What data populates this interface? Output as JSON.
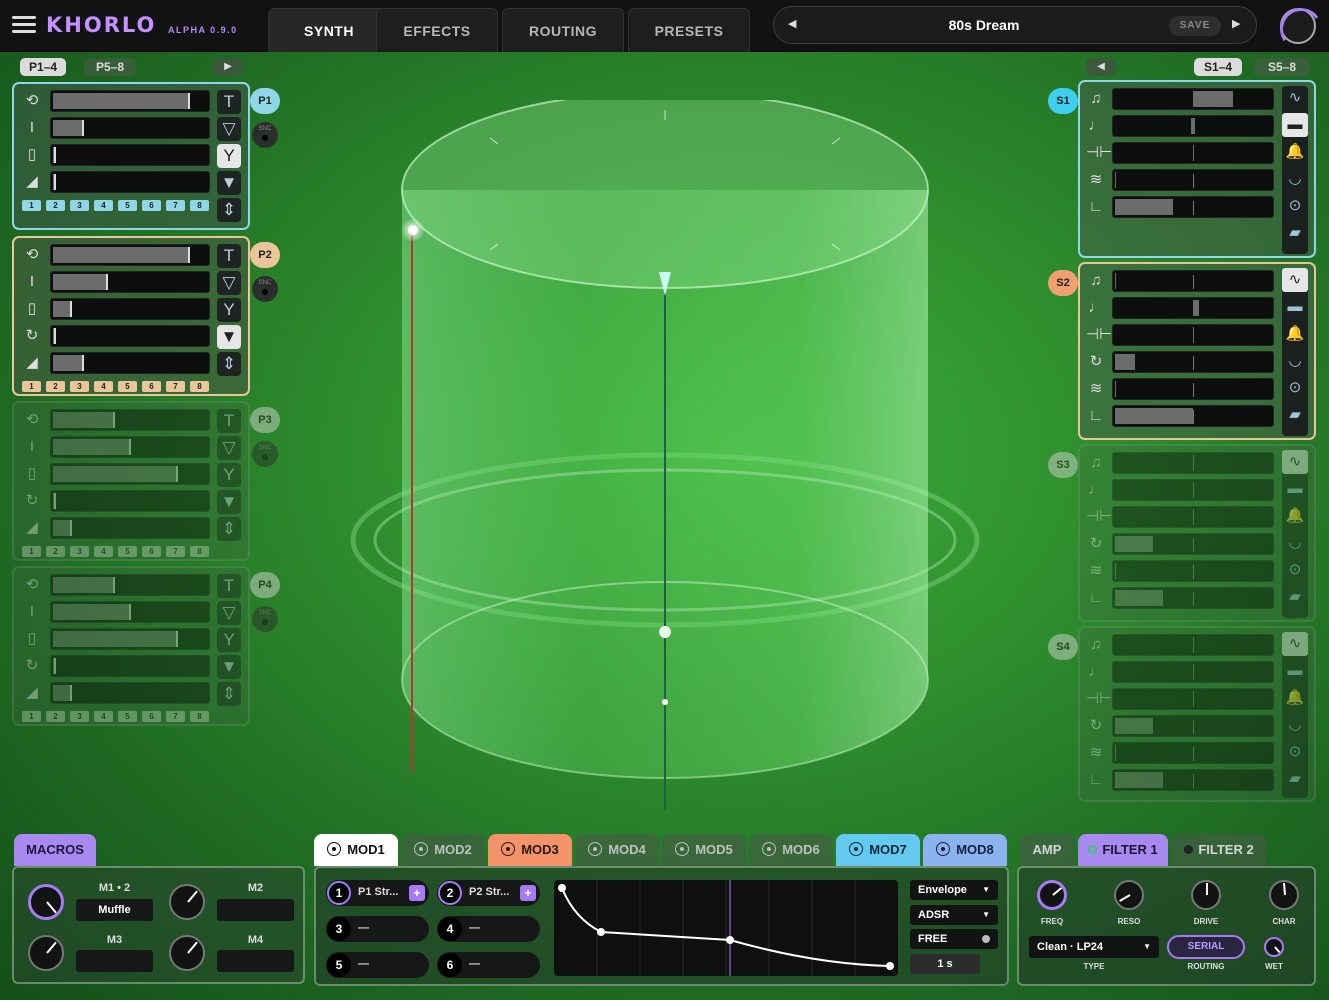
{
  "app": {
    "name": "KHORLO",
    "version": "ALPHA 0.9.0"
  },
  "tabs": [
    "SYNTH",
    "EFFECTS",
    "ROUTING",
    "PRESETS"
  ],
  "preset": {
    "name": "80s Dream",
    "save_label": "SAVE",
    "prev": "◀",
    "next": "▶"
  },
  "left_pager": {
    "p1_4": "P1–4",
    "p5_8": "P5–8",
    "next": "▶"
  },
  "right_pager": {
    "prev": "◀",
    "s1_4": "S1–4",
    "s5_8": "S5–8"
  },
  "players": [
    {
      "label": "P1",
      "snc": "SNC",
      "color": "#8fd6e6",
      "num_color": "#8fd6e6",
      "levels": [
        0.88,
        0.2,
        0.02,
        0.02
      ]
    },
    {
      "label": "P2",
      "snc": "SNC",
      "color": "#e8c69a",
      "num_color": "#e8c69a",
      "levels": [
        0.88,
        0.35,
        0.12,
        0.02,
        0.2
      ]
    },
    {
      "label": "P3",
      "snc": "SNC",
      "color": "#b6c8b3",
      "num_color": "#b6c8b3",
      "levels": [
        0.4,
        0.5,
        0.8,
        0.02,
        0.12
      ]
    },
    {
      "label": "P4",
      "snc": "SNC",
      "color": "#b6c8b3",
      "num_color": "#b6c8b3",
      "levels": [
        0.4,
        0.5,
        0.8,
        0.02,
        0.12
      ]
    }
  ],
  "step_numbers": [
    "1",
    "2",
    "3",
    "4",
    "5",
    "6",
    "7",
    "8"
  ],
  "sources": [
    {
      "label": "S1",
      "color": "#3fd0f0"
    },
    {
      "label": "S2",
      "color": "#f0a070"
    },
    {
      "label": "S3",
      "color": "#b6c8b3"
    },
    {
      "label": "S4",
      "color": "#b6c8b3"
    }
  ],
  "macros": {
    "tab": "MACROS",
    "m1": {
      "label": "M1 • 2",
      "value": "Muffle"
    },
    "m2": {
      "label": "M2",
      "value": ""
    },
    "m3": {
      "label": "M3",
      "value": ""
    },
    "m4": {
      "label": "M4",
      "value": ""
    }
  },
  "mod_tabs": [
    {
      "label": "MOD1",
      "bg": "#ffffff",
      "fg": "#111"
    },
    {
      "label": "MOD2",
      "bg": "",
      "fg": ""
    },
    {
      "label": "MOD3",
      "bg": "#f2936a",
      "fg": "#2a1a12"
    },
    {
      "label": "MOD4",
      "bg": "",
      "fg": ""
    },
    {
      "label": "MOD5",
      "bg": "",
      "fg": ""
    },
    {
      "label": "MOD6",
      "bg": "",
      "fg": ""
    },
    {
      "label": "MOD7",
      "bg": "#63c9ef",
      "fg": "#0d2a36"
    },
    {
      "label": "MOD8",
      "bg": "#8cb3f0",
      "fg": "#12223d"
    }
  ],
  "mod_slots": [
    {
      "n": "1",
      "t": "P1 Str...",
      "plus": "+"
    },
    {
      "n": "2",
      "t": "P2 Str...",
      "plus": "+"
    },
    {
      "n": "3",
      "t": "—"
    },
    {
      "n": "4",
      "t": "—"
    },
    {
      "n": "5",
      "t": "—"
    },
    {
      "n": "6",
      "t": "—"
    }
  ],
  "mod_controls": {
    "type": "Envelope",
    "mode": "ADSR",
    "sync": "FREE",
    "time": "1 s"
  },
  "filter_tabs": [
    "AMP",
    "FILTER 1",
    "FILTER 2"
  ],
  "filter": {
    "knobs": [
      "FREQ",
      "RESO",
      "DRIVE",
      "CHAR"
    ],
    "type_value": "Clean · LP24",
    "type_label": "TYPE",
    "routing_value": "SERIAL",
    "routing_label": "ROUTING",
    "wet_label": "WET"
  },
  "colors": {
    "accent": "#a77bf5",
    "p1": "#8fd6e6",
    "p2": "#e8c69a",
    "s1": "#3fd0f0",
    "s2": "#f0a070"
  }
}
